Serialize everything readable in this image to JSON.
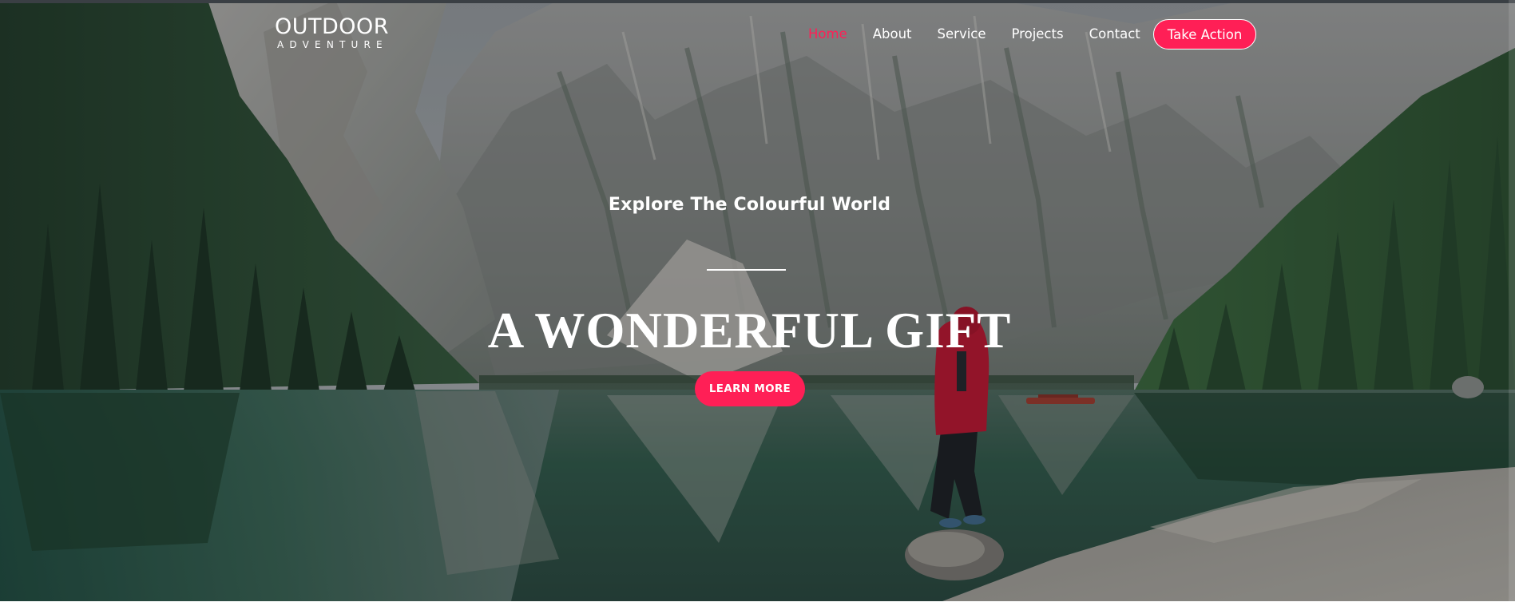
{
  "brand": {
    "name": "OUTDOOR",
    "tagline": "ADVENTURE"
  },
  "nav": {
    "items": [
      {
        "label": "Home",
        "active": true
      },
      {
        "label": "About",
        "active": false
      },
      {
        "label": "Service",
        "active": false
      },
      {
        "label": "Projects",
        "active": false
      },
      {
        "label": "Contact",
        "active": false
      }
    ],
    "cta_label": "Take Action"
  },
  "hero": {
    "eyebrow": "Explore The Colourful World",
    "headline": "A WONDERFUL GIFT",
    "button_label": "LEARN MORE",
    "background_icon": "mountain-lake-photo-icon"
  },
  "colors": {
    "accent": "#ff1f56",
    "text": "#ffffff",
    "overlay": "#14181e"
  }
}
